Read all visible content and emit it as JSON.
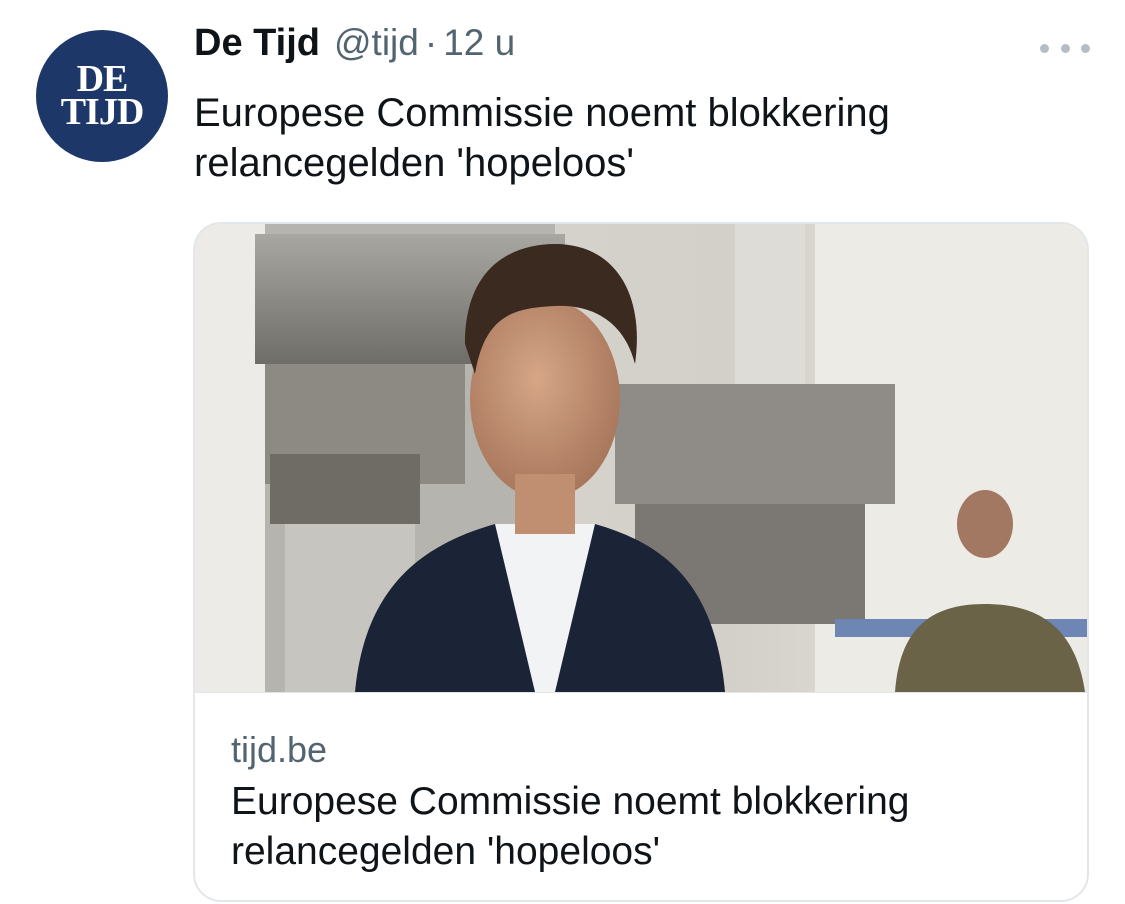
{
  "tweet": {
    "avatar": {
      "line1": "DE",
      "line2": "TIJD"
    },
    "name": "De Tijd",
    "handle": "@tijd",
    "separator": "·",
    "time": "12 u",
    "text": "Europese Commissie noemt blokkering relancegelden 'hopeloos'"
  },
  "card": {
    "domain": "tijd.be",
    "title": "Europese Commissie noemt blokkering relancegelden 'hopeloos'"
  },
  "colors": {
    "avatar_bg": "#1d3769",
    "secondary_text": "#536471",
    "primary_text": "#0f1419",
    "border": "#e3e7ea"
  },
  "icons": {
    "more": "more-horizontal-icon"
  }
}
